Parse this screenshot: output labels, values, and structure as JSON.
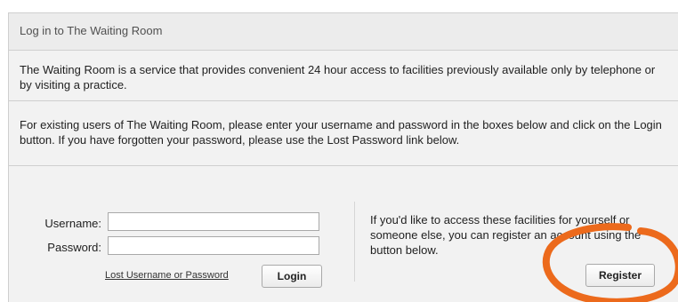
{
  "header": {
    "title": "Log in to The Waiting Room"
  },
  "intro": {
    "text": "The Waiting Room is a service that provides convenient 24 hour access to facilities previously available only by telephone or by visiting a practice."
  },
  "instructions": {
    "text": "For existing users of The Waiting Room, please enter your username and password in the boxes below and click on the Login button. If you have forgotten your password, please use the Lost Password link below."
  },
  "login": {
    "username_label": "Username:",
    "username_value": "",
    "password_label": "Password:",
    "password_value": "",
    "lost_link": "Lost Username or Password",
    "login_button": "Login"
  },
  "register": {
    "text": "If you'd like to access these facilities for yourself or someone else, you can register an account using the button below.",
    "register_button": "Register"
  },
  "annotation": {
    "highlight_color": "#ec6a1c"
  }
}
